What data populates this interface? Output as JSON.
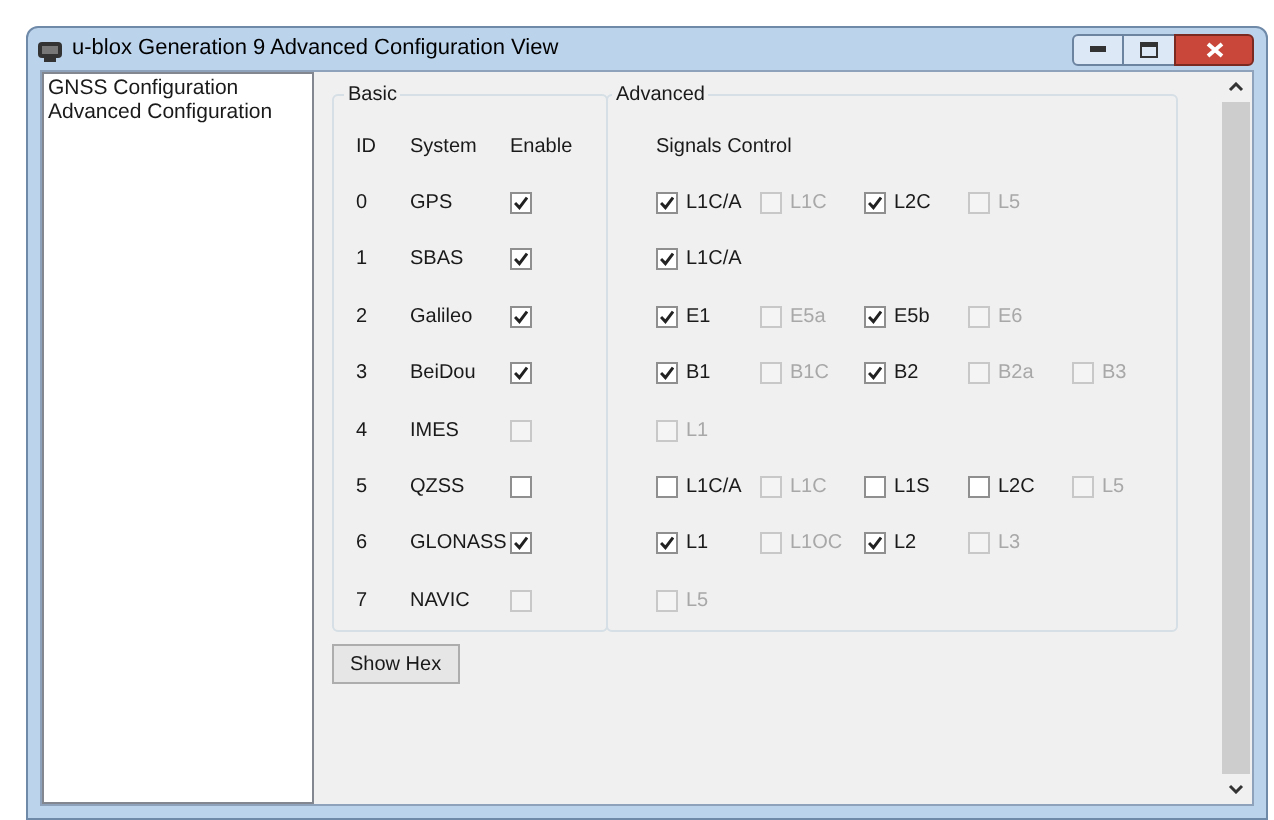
{
  "window": {
    "title": "u-blox Generation 9 Advanced Configuration View"
  },
  "tree": {
    "items": [
      {
        "label": "GNSS Configuration",
        "selected": false
      },
      {
        "label": "Advanced Configuration",
        "selected": false
      }
    ]
  },
  "basic": {
    "legend": "Basic",
    "columns": [
      "ID",
      "System",
      "Enable"
    ],
    "rows": [
      {
        "id": "0",
        "system": "GPS",
        "checked": true,
        "disabled": false
      },
      {
        "id": "1",
        "system": "SBAS",
        "checked": true,
        "disabled": false
      },
      {
        "id": "2",
        "system": "Galileo",
        "checked": true,
        "disabled": false
      },
      {
        "id": "3",
        "system": "BeiDou",
        "checked": true,
        "disabled": false
      },
      {
        "id": "4",
        "system": "IMES",
        "checked": false,
        "disabled": true
      },
      {
        "id": "5",
        "system": "QZSS",
        "checked": false,
        "disabled": false
      },
      {
        "id": "6",
        "system": "GLONASS",
        "checked": true,
        "disabled": false
      },
      {
        "id": "7",
        "system": "NAVIC",
        "checked": false,
        "disabled": true
      }
    ]
  },
  "advanced": {
    "legend": "Advanced",
    "heading": "Signals Control",
    "rows": [
      [
        {
          "label": "L1C/A",
          "checked": true,
          "disabled": false
        },
        {
          "label": "L1C",
          "checked": false,
          "disabled": true
        },
        {
          "label": "L2C",
          "checked": true,
          "disabled": false
        },
        {
          "label": "L5",
          "checked": false,
          "disabled": true
        }
      ],
      [
        {
          "label": "L1C/A",
          "checked": true,
          "disabled": false
        }
      ],
      [
        {
          "label": "E1",
          "checked": true,
          "disabled": false
        },
        {
          "label": "E5a",
          "checked": false,
          "disabled": true
        },
        {
          "label": "E5b",
          "checked": true,
          "disabled": false
        },
        {
          "label": "E6",
          "checked": false,
          "disabled": true
        }
      ],
      [
        {
          "label": "B1",
          "checked": true,
          "disabled": false
        },
        {
          "label": "B1C",
          "checked": false,
          "disabled": true
        },
        {
          "label": "B2",
          "checked": true,
          "disabled": false
        },
        {
          "label": "B2a",
          "checked": false,
          "disabled": true
        },
        {
          "label": "B3",
          "checked": false,
          "disabled": true
        }
      ],
      [
        {
          "label": "L1",
          "checked": false,
          "disabled": true
        }
      ],
      [
        {
          "label": "L1C/A",
          "checked": false,
          "disabled": false
        },
        {
          "label": "L1C",
          "checked": false,
          "disabled": true
        },
        {
          "label": "L1S",
          "checked": false,
          "disabled": false
        },
        {
          "label": "L2C",
          "checked": false,
          "disabled": false
        },
        {
          "label": "L5",
          "checked": false,
          "disabled": true
        }
      ],
      [
        {
          "label": "L1",
          "checked": true,
          "disabled": false
        },
        {
          "label": "L1OC",
          "checked": false,
          "disabled": true
        },
        {
          "label": "L2",
          "checked": true,
          "disabled": false
        },
        {
          "label": "L3",
          "checked": false,
          "disabled": true
        }
      ],
      [
        {
          "label": "L5",
          "checked": false,
          "disabled": true
        }
      ]
    ]
  },
  "buttons": [
    "Show Hex"
  ]
}
